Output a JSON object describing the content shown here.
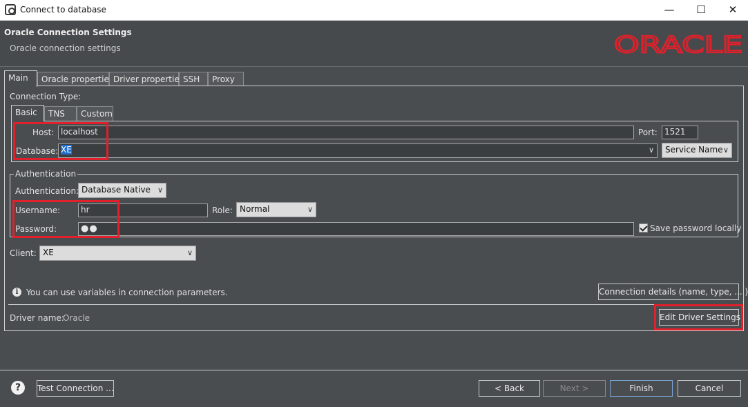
{
  "window": {
    "title": "Connect to database"
  },
  "header": {
    "title": "Oracle Connection Settings",
    "subtitle": "Oracle connection settings",
    "logo_text": "ORACLE",
    "logo_color": "#e0202b"
  },
  "main_tabs": [
    {
      "label": "Main",
      "active": true
    },
    {
      "label": "Oracle properties"
    },
    {
      "label": "Driver properties"
    },
    {
      "label": "SSH"
    },
    {
      "label": "Proxy"
    }
  ],
  "connection": {
    "type_label": "Connection Type:",
    "tabs": [
      {
        "label": "Basic",
        "active": true
      },
      {
        "label": "TNS"
      },
      {
        "label": "Custom"
      }
    ],
    "host_label": "Host:",
    "host_value": "localhost",
    "port_label": "Port:",
    "port_value": "1521",
    "database_label": "Database:",
    "database_value": "XE",
    "service_type": "Service Name"
  },
  "auth": {
    "group_title": "Authentication",
    "auth_label": "Authentication:",
    "auth_value": "Database Native",
    "username_label": "Username:",
    "username_value": "hr",
    "role_label": "Role:",
    "role_value": "Normal",
    "password_label": "Password:",
    "password_value": "●●",
    "save_password_label": "Save password locally",
    "save_password_checked": true
  },
  "client": {
    "label": "Client:",
    "value": "XE"
  },
  "info": {
    "text": "You can use variables in connection parameters.",
    "details_button": "Connection details (name, type, ... )"
  },
  "driver": {
    "label": "Driver name:",
    "value": "Oracle",
    "edit_button": "Edit Driver Settings"
  },
  "footer": {
    "test_button": "Test Connection ...",
    "back_button": "< Back",
    "next_button": "Next >",
    "finish_button": "Finish",
    "cancel_button": "Cancel"
  },
  "highlight_color": "#e0202b"
}
